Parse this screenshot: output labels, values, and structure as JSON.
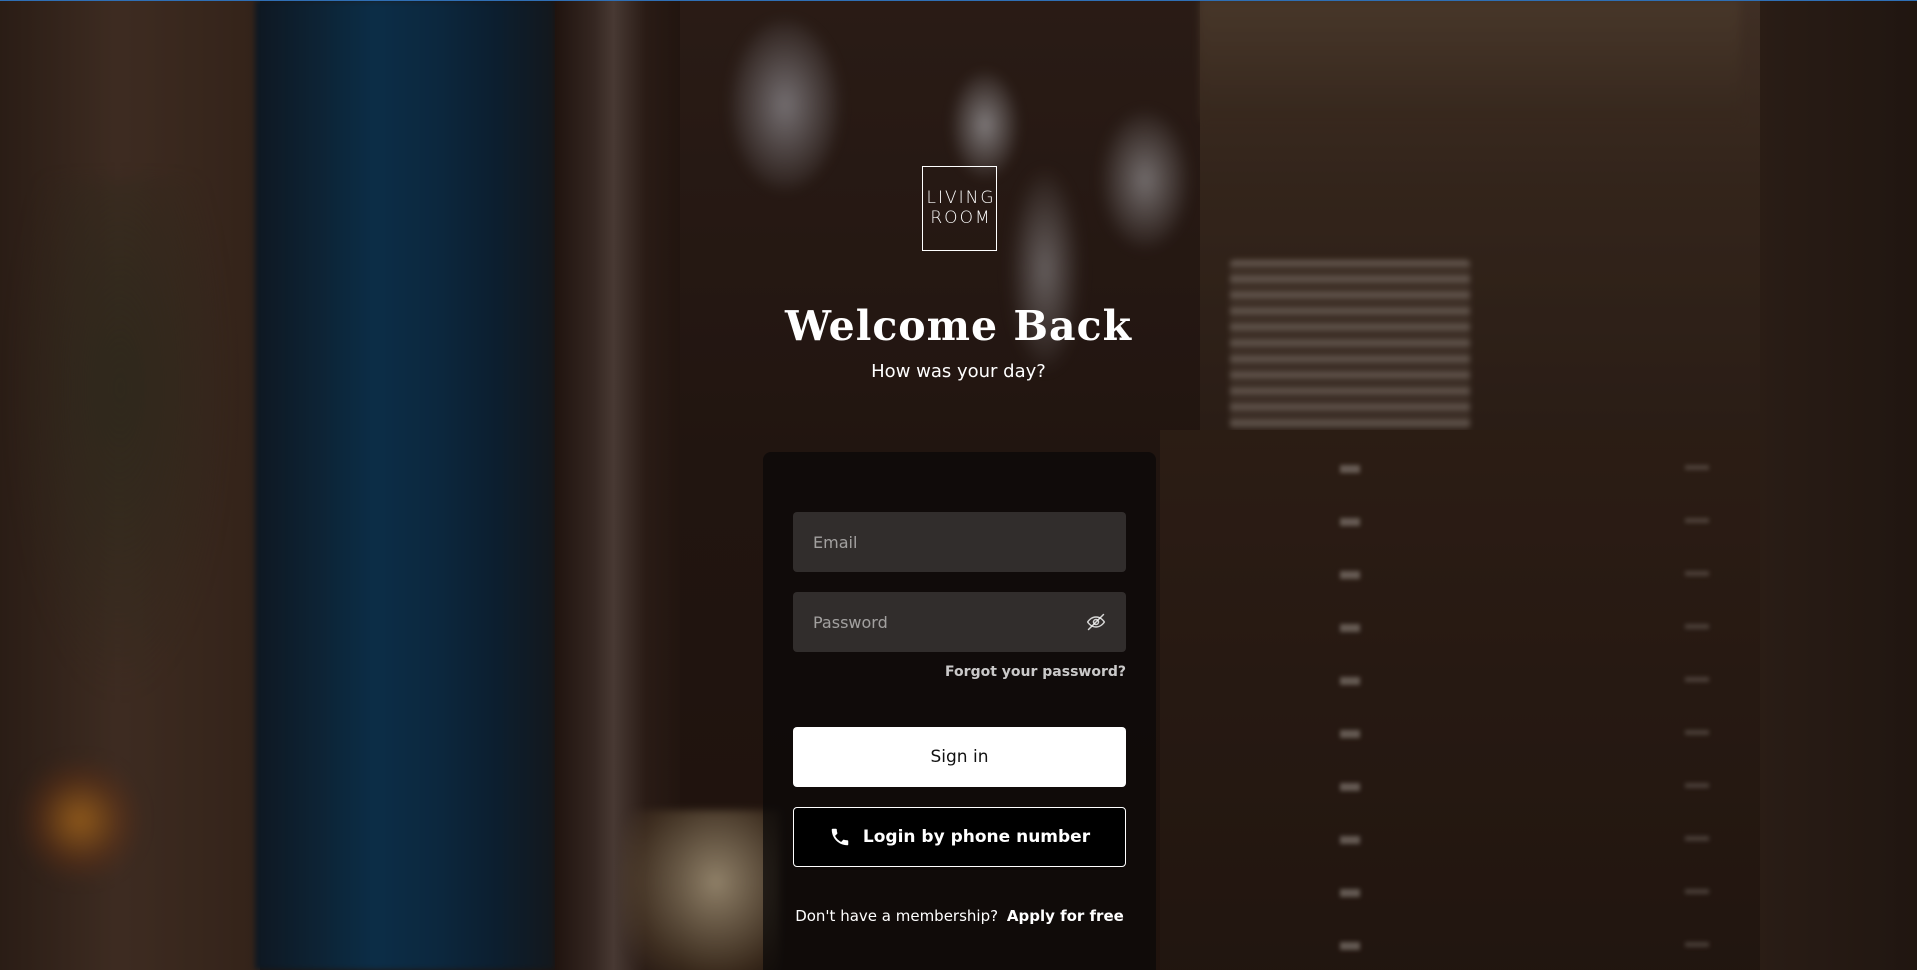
{
  "brand": {
    "logo_line1": "LIVING",
    "logo_line2": "ROOM"
  },
  "header": {
    "title": "Welcome Back",
    "subtitle": "How was your day?"
  },
  "form": {
    "email_placeholder": "Email",
    "email_value": "",
    "password_placeholder": "Password",
    "password_value": "",
    "password_toggle_icon": "eye-off-icon",
    "forgot_label": "Forgot your password?",
    "signin_label": "Sign in",
    "phone_login_label": "Login by phone number",
    "phone_icon": "phone-icon"
  },
  "footer": {
    "membership_text": "Don't have a membership?",
    "apply_label": "Apply for free"
  },
  "colors": {
    "card_bg": "#0a0808",
    "signin_bg": "#ffffff",
    "phone_btn_bg": "#000000",
    "text": "#ffffff"
  }
}
